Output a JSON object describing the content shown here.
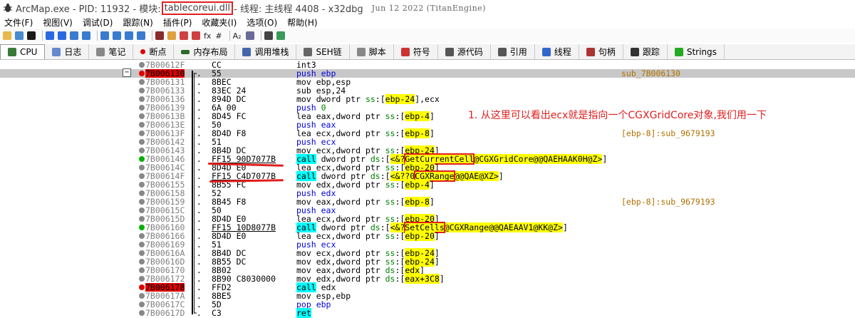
{
  "title": {
    "app": "ArcMap.exe - PID: 11932 - 模块:",
    "module": "tablecoreui.dll",
    "thread": "- 线程: 主线程 4408 - x32dbg",
    "date": "Jun 12 2022 (TitanEngine)"
  },
  "menu": [
    "文件(F)",
    "视图(V)",
    "调试(D)",
    "跟踪(N)",
    "插件(P)",
    "收藏夹(I)",
    "选项(O)",
    "帮助(H)"
  ],
  "toolbar": {
    "fx": "fx",
    "hash": "#",
    "az": "A₂"
  },
  "tabs": [
    {
      "label": "CPU",
      "icon": "cpu-icon",
      "color": "#3a7a3a"
    },
    {
      "label": "日志",
      "icon": "log-icon",
      "color": "#6688cc"
    },
    {
      "label": "笔记",
      "icon": "notes-icon",
      "color": "#888888"
    },
    {
      "label": "断点",
      "icon": "breakpoint-icon",
      "color": "#e00000"
    },
    {
      "label": "内存布局",
      "icon": "memory-icon",
      "color": "#2a6a2a"
    },
    {
      "label": "调用堆栈",
      "icon": "callstack-icon",
      "color": "#4466aa"
    },
    {
      "label": "SEH链",
      "icon": "seh-icon",
      "color": "#666666"
    },
    {
      "label": "脚本",
      "icon": "script-icon",
      "color": "#888888"
    },
    {
      "label": "符号",
      "icon": "symbol-icon",
      "color": "#cc3333"
    },
    {
      "label": "源代码",
      "icon": "source-icon",
      "color": "#555555"
    },
    {
      "label": "引用",
      "icon": "reference-icon",
      "color": "#555555"
    },
    {
      "label": "线程",
      "icon": "thread-icon",
      "color": "#3366cc"
    },
    {
      "label": "句柄",
      "icon": "handle-icon",
      "color": "#aa3333"
    },
    {
      "label": "跟踪",
      "icon": "trace-icon",
      "color": "#333333"
    },
    {
      "label": "Strings",
      "icon": "strings-icon",
      "color": "#22aa22"
    }
  ],
  "annotation": "1. 从这里可以看出ecx就是指向一个CGXGridCore对象,我们用一下",
  "rows": [
    {
      "addr": "7B00612F",
      "bytes": "CC",
      "instr": "int3",
      "comment": ""
    },
    {
      "addr": "7B006130",
      "bytes": "55",
      "instr": "push ebp",
      "comment": "sub_7B006130"
    },
    {
      "addr": "7B006131",
      "bytes": "8BEC",
      "instr": "mov ebp,esp",
      "comment": ""
    },
    {
      "addr": "7B006133",
      "bytes": "83EC 24",
      "instr": "sub esp,24",
      "comment": ""
    },
    {
      "addr": "7B006136",
      "bytes": "894D DC",
      "instr": "mov dword ptr ss:[ebp-24],ecx",
      "comment": ""
    },
    {
      "addr": "7B006139",
      "bytes": "6A 00",
      "instr": "push 0",
      "comment": ""
    },
    {
      "addr": "7B00613B",
      "bytes": "8D45 FC",
      "instr": "lea eax,dword ptr ss:[ebp-4]",
      "comment": ""
    },
    {
      "addr": "7B00613E",
      "bytes": "50",
      "instr": "push eax",
      "comment": ""
    },
    {
      "addr": "7B00613F",
      "bytes": "8D4D F8",
      "instr": "lea ecx,dword ptr ss:[ebp-8]",
      "comment": "[ebp-8]:sub_9679193"
    },
    {
      "addr": "7B006142",
      "bytes": "51",
      "instr": "push ecx",
      "comment": ""
    },
    {
      "addr": "7B006143",
      "bytes": "8B4D DC",
      "instr": "mov ecx,dword ptr ss:[ebp-24]",
      "comment": ""
    },
    {
      "addr": "7B006146",
      "bytes": "FF15 90D7077B",
      "instr": "call dword ptr ds:[<&?GetCurrentCell@CGXGridCore@@QAEHAAK0H@Z>]",
      "comment": ""
    },
    {
      "addr": "7B00614C",
      "bytes": "8D4D E0",
      "instr": "lea ecx,dword ptr ss:[ebp-20]",
      "comment": ""
    },
    {
      "addr": "7B00614F",
      "bytes": "FF15 C4D7077B",
      "instr": "call dword ptr ds:[<&??0CGXRange@@QAE@XZ>]",
      "comment": ""
    },
    {
      "addr": "7B006155",
      "bytes": "8B55 FC",
      "instr": "mov edx,dword ptr ss:[ebp-4]",
      "comment": ""
    },
    {
      "addr": "7B006158",
      "bytes": "52",
      "instr": "push edx",
      "comment": ""
    },
    {
      "addr": "7B006159",
      "bytes": "8B45 F8",
      "instr": "mov eax,dword ptr ss:[ebp-8]",
      "comment": "[ebp-8]:sub_9679193"
    },
    {
      "addr": "7B00615C",
      "bytes": "50",
      "instr": "push eax",
      "comment": ""
    },
    {
      "addr": "7B00615D",
      "bytes": "8D4D E0",
      "instr": "lea ecx,dword ptr ss:[ebp-20]",
      "comment": ""
    },
    {
      "addr": "7B006160",
      "bytes": "FF15 10D8077B",
      "instr": "call dword ptr ds:[<&?SetCells@CGXRange@@QAEAAV1@KK@Z>]",
      "comment": ""
    },
    {
      "addr": "7B006166",
      "bytes": "8D4D E0",
      "instr": "lea ecx,dword ptr ss:[ebp-20]",
      "comment": ""
    },
    {
      "addr": "7B006169",
      "bytes": "51",
      "instr": "push ecx",
      "comment": ""
    },
    {
      "addr": "7B00616A",
      "bytes": "8B4D DC",
      "instr": "mov ecx,dword ptr ss:[ebp-24]",
      "comment": ""
    },
    {
      "addr": "7B00616D",
      "bytes": "8B55 DC",
      "instr": "mov edx,dword ptr ss:[ebp-24]",
      "comment": ""
    },
    {
      "addr": "7B006170",
      "bytes": "8B02",
      "instr": "mov eax,dword ptr ds:[edx]",
      "comment": ""
    },
    {
      "addr": "7B006172",
      "bytes": "8B90 C8030000",
      "instr": "mov edx,dword ptr ds:[eax+3C8]",
      "comment": ""
    },
    {
      "addr": "7B006178",
      "bytes": "FFD2",
      "instr": "call edx",
      "comment": ""
    },
    {
      "addr": "7B00617A",
      "bytes": "8BE5",
      "instr": "mov esp,ebp",
      "comment": ""
    },
    {
      "addr": "7B00617C",
      "bytes": "5D",
      "instr": "pop ebp",
      "comment": ""
    },
    {
      "addr": "7B00617D",
      "bytes": "C3",
      "instr": "ret",
      "comment": ""
    }
  ]
}
